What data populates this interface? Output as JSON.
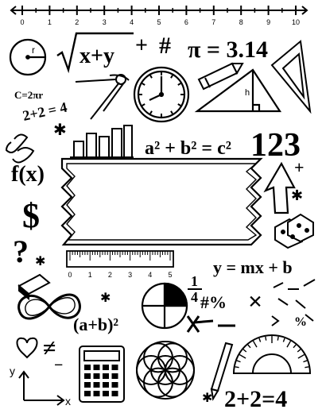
{
  "colors": {
    "ink": "#000000",
    "paper": "#ffffff",
    "frame_fill": "#ffffff"
  },
  "number_line": {
    "labels": [
      "0",
      "1",
      "2",
      "3",
      "4",
      "5",
      "6",
      "7",
      "8",
      "9",
      "10"
    ]
  },
  "formulas": {
    "sqrt_expr": "x+y",
    "plus_sign": "+",
    "hash_sign": "#",
    "pi_value": "π = 3.14",
    "circumference": "C=2πr",
    "add_two": "2+2 = 4",
    "pythagoras": "a² + b² = c²",
    "one_two_three": "123",
    "function": "f(x)",
    "dollar": "$",
    "question": "?",
    "slope": "y = mx + b",
    "fraction_num": "1",
    "fraction_den": "4",
    "percent_hash": "#%",
    "times": "×",
    "square_expr": "(a+b)²",
    "not_equal": "≠",
    "minus": "−",
    "small_plus": "+",
    "axis_y": "y",
    "axis_x": "x",
    "final_sum": "2+2=4",
    "percent_small": "%",
    "triangle_h": "h",
    "circle_r": "r"
  },
  "ruler": {
    "labels": [
      "0",
      "1",
      "2",
      "3",
      "4",
      "5"
    ]
  },
  "icons": {
    "circle_icon": "circle-radius-icon",
    "clock_icon": "clock-icon",
    "compass_icon": "compass-icon",
    "pencil_icon": "pencil-icon",
    "triangle_icon": "triangle-ruler-icon",
    "bar_chart_icon": "bar-chart-icon",
    "arrow_up_icon": "arrow-up-icon",
    "dice_icon": "dice-icon",
    "eraser_icon": "eraser-icon",
    "infinity_icon": "infinity-icon",
    "pie_chart_icon": "pie-chart-icon",
    "calculator_icon": "calculator-icon",
    "flower_icon": "flower-of-life-icon",
    "protractor_icon": "protractor-icon",
    "heart_icon": "heart-icon",
    "paperclip_icon": "paperclip-icon",
    "star_icon": "asterisk-icon"
  }
}
